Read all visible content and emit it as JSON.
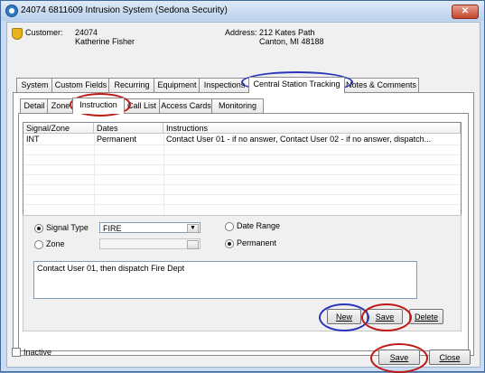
{
  "window": {
    "title": "24074 6811609 Intrusion System (Sedona Security)",
    "close_glyph": "✕"
  },
  "customer": {
    "label": "Customer:",
    "id": "24074",
    "name": "Katherine Fisher"
  },
  "address": {
    "label": "Address:",
    "line1": "212  Kates Path",
    "line2": "Canton, MI  48188"
  },
  "main_tabs": [
    "System",
    "Custom Fields",
    "Recurring",
    "Equipment",
    "Inspections",
    "Central Station Tracking",
    "Notes & Comments"
  ],
  "main_tab_active": "Central Station Tracking",
  "sub_tabs": [
    "Detail",
    "Zone",
    "Instruction",
    "Call List",
    "Access Cards",
    "Monitoring"
  ],
  "sub_tab_active": "Instruction",
  "grid": {
    "columns": [
      "Signal/Zone",
      "Dates",
      "Instructions"
    ],
    "rows": [
      {
        "signal": "INT",
        "dates": "Permanent",
        "instructions": "Contact User 01 - if no answer, Contact User 02 - if no answer, dispatch..."
      }
    ]
  },
  "form": {
    "signal_type_label": "Signal Type",
    "signal_type_value": "FIRE",
    "zone_label": "Zone",
    "zone_value": "",
    "date_range_label": "Date Range",
    "permanent_label": "Permanent",
    "instruction_text": "Contact User 01, then dispatch Fire Dept"
  },
  "buttons": {
    "new": "New",
    "save": "Save",
    "delete": "Delete",
    "save_main": "Save",
    "close": "Close"
  },
  "inactive_label": "Inactive",
  "annotation_colors": {
    "red": "#c01818",
    "blue": "#2a36b8"
  }
}
